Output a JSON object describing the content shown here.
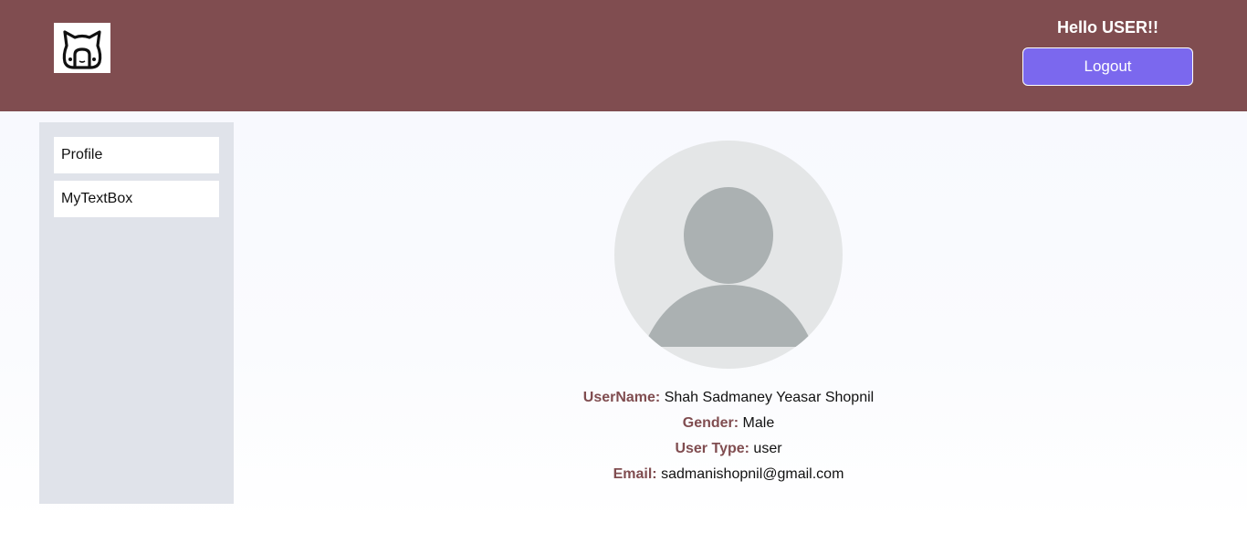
{
  "header": {
    "logo_icon": "cat-face-icon",
    "greeting": "Hello USER!!",
    "logout_label": "Logout"
  },
  "sidebar": {
    "items": [
      {
        "label": "Profile"
      },
      {
        "label": "MyTextBox"
      }
    ]
  },
  "profile": {
    "avatar_icon": "user-avatar-icon",
    "username_label": "UserName:",
    "username_value": "Shah Sadmaney Yeasar Shopnil",
    "gender_label": "Gender:",
    "gender_value": "Male",
    "usertype_label": "User Type:",
    "usertype_value": "user",
    "email_label": "Email:",
    "email_value": "sadmanishopnil@gmail.com"
  },
  "colors": {
    "header_bg": "#804d50",
    "accent_button": "#7b68ee",
    "label_color": "#804d50",
    "sidebar_bg": "#e0e3ea"
  }
}
